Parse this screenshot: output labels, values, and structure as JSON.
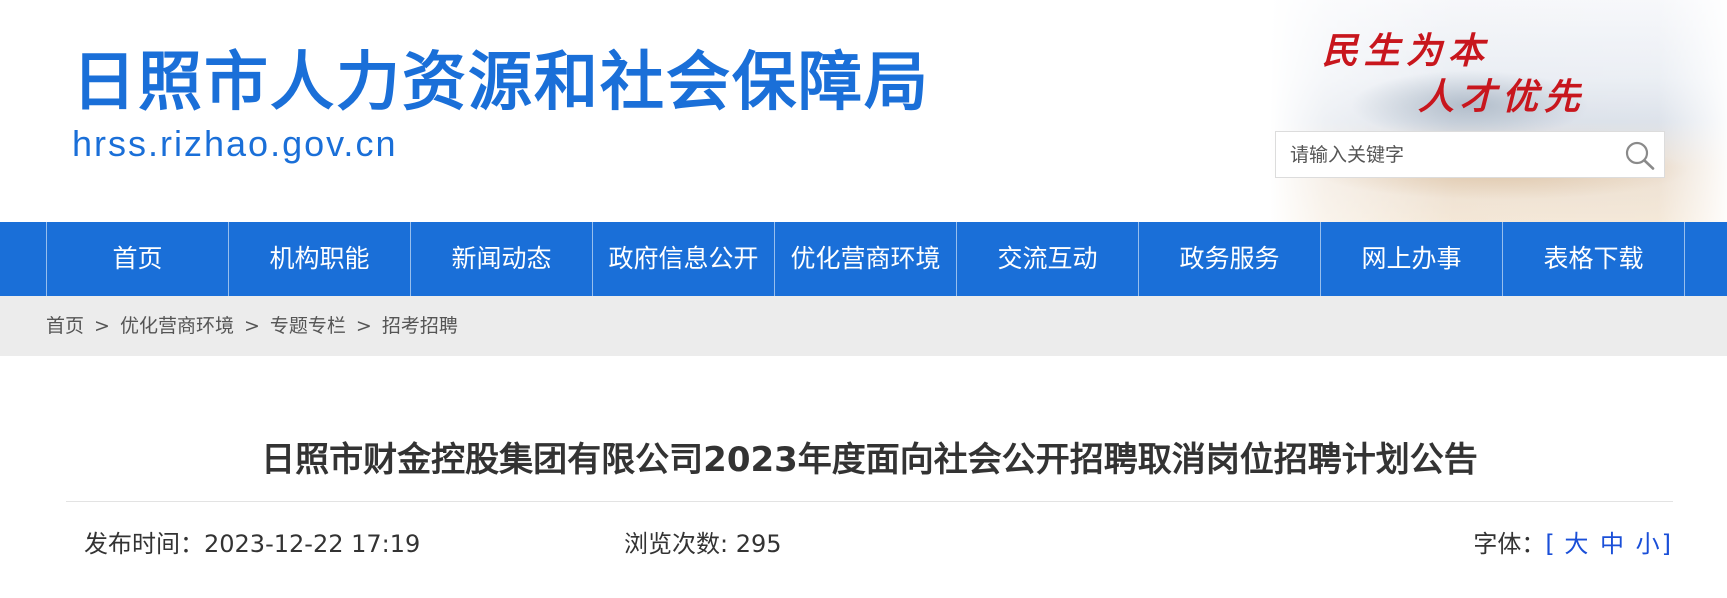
{
  "header": {
    "site_title": "日照市人力资源和社会保障局",
    "site_domain": "hrss.rizhao.gov.cn",
    "slogan_line1": "民生为本",
    "slogan_line2": "人才优先",
    "search": {
      "placeholder": "请输入关键字",
      "icon": "search-icon"
    }
  },
  "nav": {
    "items": [
      {
        "label": "首页"
      },
      {
        "label": "机构职能"
      },
      {
        "label": "新闻动态"
      },
      {
        "label": "政府信息公开"
      },
      {
        "label": "优化营商环境"
      },
      {
        "label": "交流互动"
      },
      {
        "label": "政务服务"
      },
      {
        "label": "网上办事"
      },
      {
        "label": "表格下载"
      }
    ]
  },
  "breadcrumb": {
    "items": [
      {
        "label": "首页"
      },
      {
        "label": "优化营商环境"
      },
      {
        "label": "专题专栏"
      },
      {
        "label": "招考招聘"
      }
    ],
    "separator": ">"
  },
  "article": {
    "title": "日照市财金控股集团有限公司2023年度面向社会公开招聘取消岗位招聘计划公告",
    "publish_label": "发布时间：",
    "publish_time": "2023-12-22 17:19",
    "views_label": "浏览次数: ",
    "views_count": "295",
    "font_label": "字体：",
    "font_open": "[",
    "font_large": "大",
    "font_medium": "中",
    "font_small": "小",
    "font_close": "]"
  },
  "colors": {
    "brand_blue": "#1a6fd8",
    "slogan_red": "#c8161d",
    "breadcrumb_bg": "#ececec"
  }
}
